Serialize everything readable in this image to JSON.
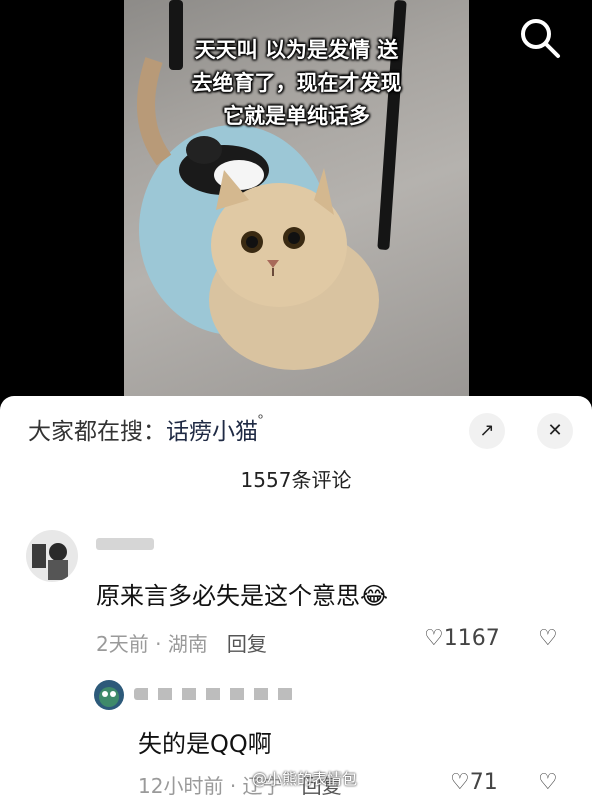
{
  "video": {
    "caption_lines": [
      "天天叫 以为是发情 送",
      "去绝育了，现在才发现",
      "它就是单纯话多"
    ],
    "search_icon": "search-icon"
  },
  "sheet": {
    "trending_prefix": "大家都在搜：",
    "trending_keyword": "话痨小猫",
    "expand_icon": "↗",
    "close_icon": "✕",
    "comment_count": "1557条评论"
  },
  "comments": [
    {
      "text": "原来言多必失是这个意思",
      "emoji": "😂",
      "time": "2天前",
      "sep": "·",
      "location": "湖南",
      "reply_label": "回复",
      "likes": "1167"
    },
    {
      "text": "失的是QQ啊",
      "time": "12小时前",
      "sep": "·",
      "location": "辽宁",
      "reply_label": "回复",
      "likes": "71"
    }
  ],
  "watermark": "@小熊的表情包"
}
